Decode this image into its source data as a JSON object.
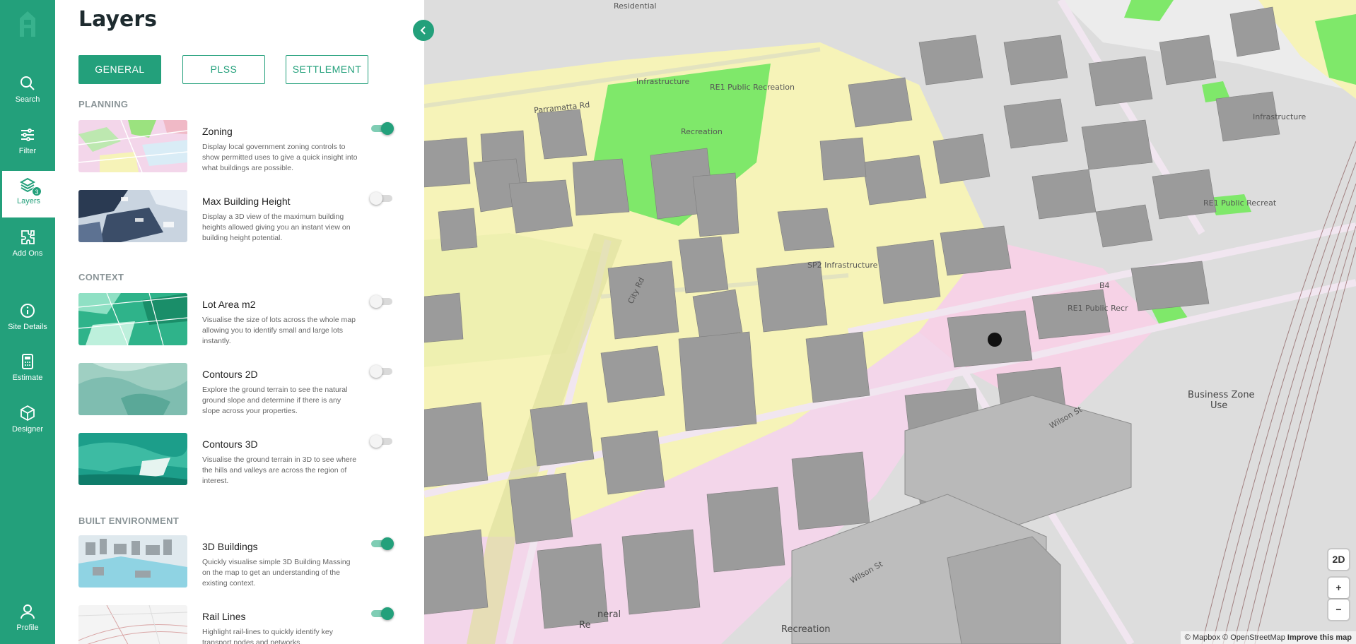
{
  "nav": {
    "items": [
      {
        "label": "Search",
        "icon": "search-icon"
      },
      {
        "label": "Filter",
        "icon": "sliders-icon"
      },
      {
        "label": "Layers",
        "icon": "layers-icon",
        "badge": "3"
      },
      {
        "label": "Add Ons",
        "icon": "puzzle-icon"
      },
      {
        "label": "Site Details",
        "icon": "info-icon"
      },
      {
        "label": "Estimate",
        "icon": "calculator-icon"
      },
      {
        "label": "Designer",
        "icon": "cube-icon"
      },
      {
        "label": "Profile",
        "icon": "user-icon"
      }
    ]
  },
  "panel": {
    "title": "Layers",
    "tabs": [
      "GENERAL",
      "PLSS",
      "SETTLEMENT"
    ],
    "sections": {
      "planning": "PLANNING",
      "context": "CONTEXT",
      "built": "BUILT ENVIRONMENT"
    },
    "layers": [
      {
        "title": "Zoning",
        "desc": "Display local government zoning controls to show permitted uses to give a quick insight into what buildings are possible.",
        "on": true
      },
      {
        "title": "Max Building Height",
        "desc": "Display a 3D view of the maximum building heights allowed giving you an instant view on building height potential.",
        "on": false
      },
      {
        "title": "Lot Area m2",
        "desc": "Visualise the size of lots across the whole map allowing you to identify small and large lots instantly.",
        "on": false
      },
      {
        "title": "Contours 2D",
        "desc": "Explore the ground terrain to see the natural ground slope and determine if there is any slope across your properties.",
        "on": false
      },
      {
        "title": "Contours 3D",
        "desc": "Visualise the ground terrain in 3D to see where the hills and valleys are across the region of interest.",
        "on": false
      },
      {
        "title": "3D Buildings",
        "desc": "Quickly visualise simple 3D Building Massing on the map to get an understanding of the existing context.",
        "on": true
      },
      {
        "title": "Rail Lines",
        "desc": "Highlight rail-lines to quickly identify key transport nodes and networks.",
        "on": true
      }
    ]
  },
  "map": {
    "labels": {
      "residential": "Residential",
      "re1_top": "RE1 Public Recreation",
      "recreation_mid": "Recreation",
      "parramatta": "Parramatta Rd",
      "infrastructure": "Infrastructure",
      "sp2": "SP2 Infrastructure",
      "city_rd": "City Rd",
      "re1_right": "RE1 Public Recr",
      "re1_far": "RE1 Public Recreat",
      "business": "Business Zone",
      "use": "Use",
      "wilson1": "Wilson St",
      "wilson2": "Wilson St",
      "recreation_bottom": "Recreation",
      "infrastructure_r": "Infrastructure",
      "b4": "B4",
      "neral": "neral",
      "rc": "Re"
    },
    "controls": {
      "mode": "2D",
      "zoom_in": "+",
      "zoom_out": "−"
    },
    "attribution": {
      "mapbox": "© Mapbox",
      "osm": "© OpenStreetMap",
      "improve": "Improve this map"
    }
  }
}
